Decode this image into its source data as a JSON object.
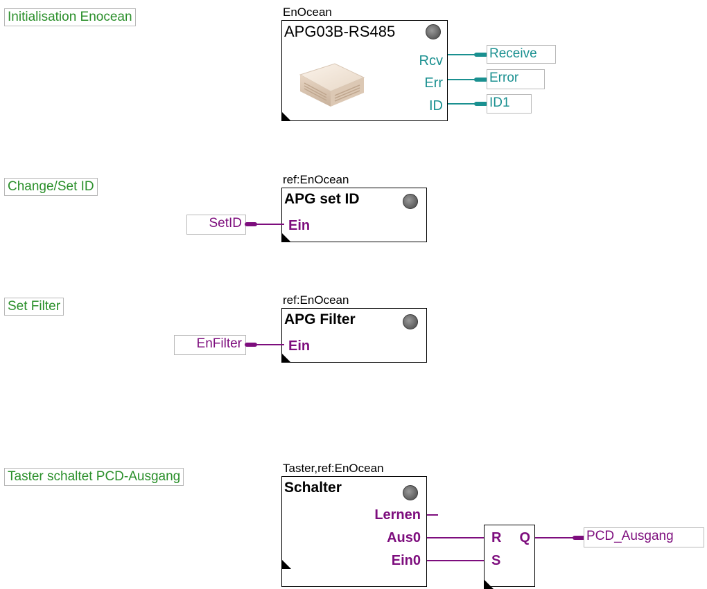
{
  "comments": {
    "init": "Initialisation Enocean",
    "change_id": "Change/Set ID",
    "set_filter": "Set Filter",
    "taster": "Taster schaltet PCD-Ausgang"
  },
  "fb_init": {
    "label": "EnOcean",
    "title": "APG03B-RS485",
    "pins": {
      "rcv": "Rcv",
      "err": "Err",
      "id": "ID"
    },
    "outputs": {
      "receive": "Receive",
      "error": "Error",
      "id1": "ID1"
    }
  },
  "fb_setid": {
    "label": "ref:EnOcean",
    "title": "APG set ID",
    "pin_in": "Ein",
    "input": "SetID"
  },
  "fb_filter": {
    "label": "ref:EnOcean",
    "title": "APG Filter",
    "pin_in": "Ein",
    "input": "EnFilter"
  },
  "fb_schalter": {
    "label": "Taster,ref:EnOcean",
    "title": "Schalter",
    "pins": {
      "lernen": "Lernen",
      "aus0": "Aus0",
      "ein0": "Ein0"
    }
  },
  "rs_flipflop": {
    "r": "R",
    "q": "Q",
    "s": "S",
    "output": "PCD_Ausgang"
  },
  "colors": {
    "comment": "#2a8f2a",
    "teal": "#1a9090",
    "purple": "#7d0d7d"
  }
}
